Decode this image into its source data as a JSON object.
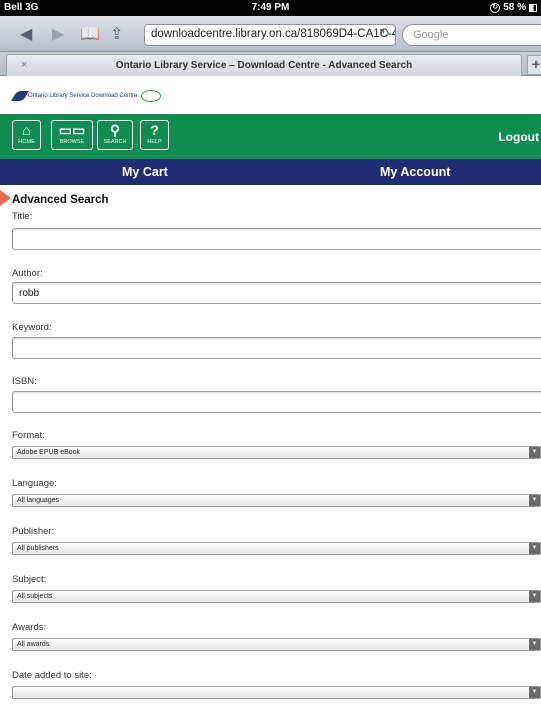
{
  "status": {
    "carrier": "Bell 3G",
    "time": "7:49 PM",
    "battery": "58 %"
  },
  "browser": {
    "url": "downloadcentre.library.on.ca/818069D4-CA1C-4",
    "search_placeholder": "Google",
    "tab_title": "Ontario Library Service – Download Centre - Advanced Search",
    "tab_close": "×",
    "new_tab": "+"
  },
  "site": {
    "logo_text": "Ontario Library Service Download Centre",
    "nav": [
      {
        "icon": "home-icon",
        "label": "HOME"
      },
      {
        "icon": "browse-icon",
        "label": "BROWSE"
      },
      {
        "icon": "search-icon",
        "label": "SEARCH"
      },
      {
        "icon": "help-icon",
        "label": "HELP"
      }
    ],
    "logout": "Logout",
    "my_cart": "My Cart",
    "my_account": "My Account",
    "colors": {
      "green": "#0f8c50",
      "navy": "#1f2d73",
      "arrow": "#e96a52"
    }
  },
  "form": {
    "title": "Advanced Search",
    "title_label": "Title:",
    "title_value": "",
    "author_label": "Author:",
    "author_value": "robb",
    "keyword_label": "Keyword:",
    "keyword_value": "",
    "isbn_label": "ISBN:",
    "isbn_value": "",
    "format_label": "Format:",
    "format_value": "Adobe EPUB eBook",
    "language_label": "Language:",
    "language_value": "All languages",
    "publisher_label": "Publisher:",
    "publisher_value": "All publishers",
    "subject_label": "Subject:",
    "subject_value": "All subjects",
    "awards_label": "Awards:",
    "awards_value": "All awards",
    "date_label": "Date added to site:",
    "date_value": ""
  }
}
